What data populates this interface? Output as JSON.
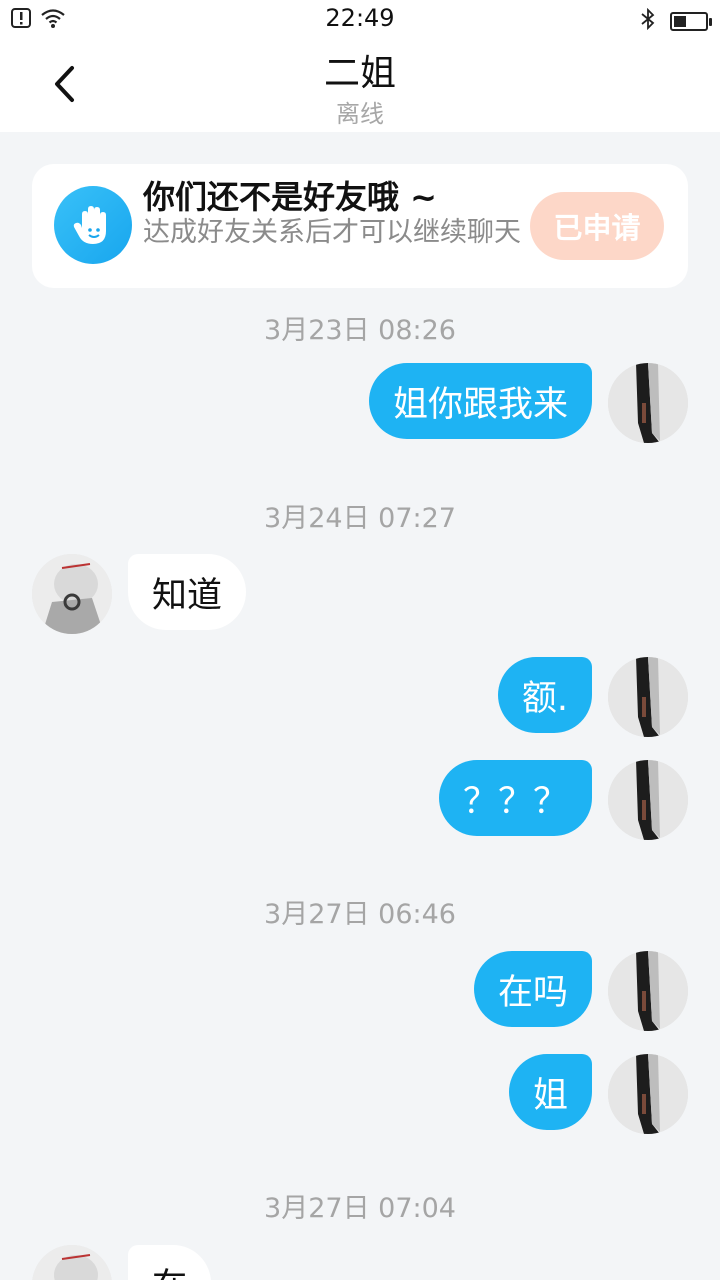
{
  "status_bar": {
    "time": "22:49",
    "left_icons": [
      "alert-sim-icon",
      "wifi-icon"
    ],
    "right_icons": [
      "bluetooth-icon",
      "battery-icon"
    ],
    "battery_level": 0.35
  },
  "header": {
    "title": "二姐",
    "subtitle": "离线",
    "back_icon": "chevron-left-icon"
  },
  "banner": {
    "title": "你们还不是好友哦 ~",
    "description": "达成好友关系后才可以继续聊天",
    "button_label": "已申请",
    "icon": "hand-wave-icon"
  },
  "messages": {
    "ts0": "3月23日 08:26",
    "m1": "姐你跟我来",
    "ts1": "3月24日 07:27",
    "m2": "知道",
    "m3": "额.",
    "m4": "？？？",
    "ts2": "3月27日 06:46",
    "m5": "在吗",
    "m6": "姐",
    "ts3": "3月27日 07:04",
    "m7": "在"
  },
  "colors": {
    "accent": "#1eb3f3",
    "button_disabled": "#fdd7c8",
    "background": "#f3f5f7"
  }
}
